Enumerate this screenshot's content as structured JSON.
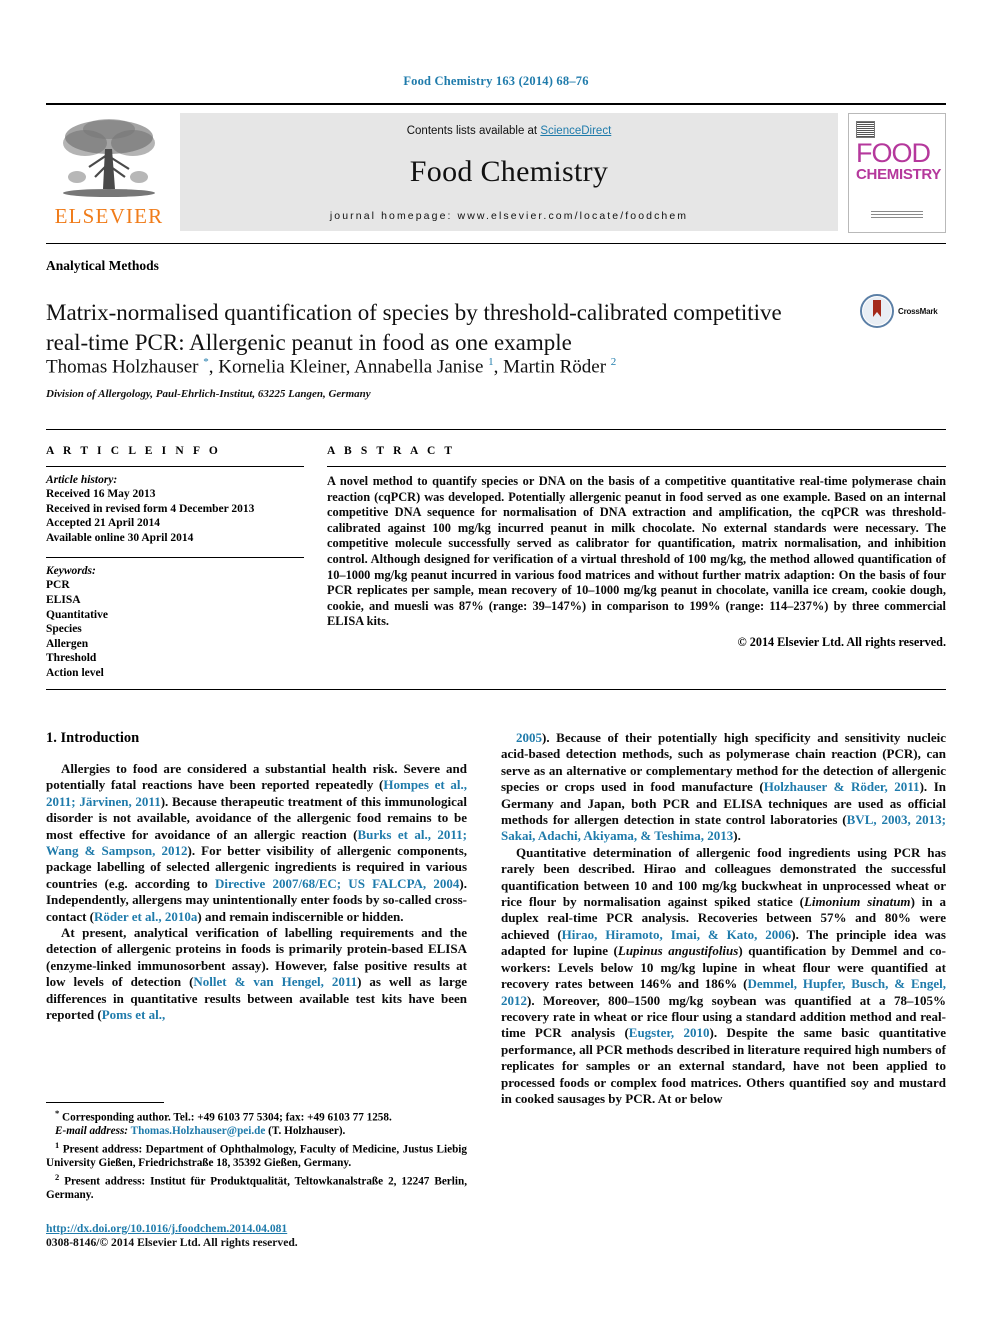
{
  "running_head": "Food Chemistry 163 (2014) 68–76",
  "masthead": {
    "contents_prefix": "Contents lists available at ",
    "contents_link": "ScienceDirect",
    "journal_title": "Food Chemistry",
    "homepage": "journal homepage: www.elsevier.com/locate/foodchem",
    "publisher": "ELSEVIER",
    "cover": {
      "line1": "FOOD",
      "line2": "CHEMISTRY"
    }
  },
  "article": {
    "section_label": "Analytical Methods",
    "title": "Matrix-normalised quantification of species by threshold-calibrated competitive real-time PCR: Allergenic peanut in food as one example",
    "crossmark_label": "CrossMark",
    "authors_html": "Thomas Holzhauser <sup>*</sup>, Kornelia Kleiner, Annabella Janise <sup>1</sup>, Martin Röder <sup>2</sup>",
    "affiliation": "Division of Allergology, Paul-Ehrlich-Institut, 63225 Langen, Germany"
  },
  "info": {
    "heading": "A R T I C L E   I N F O",
    "history_label": "Article history:",
    "history": [
      "Received 16 May 2013",
      "Received in revised form 4 December 2013",
      "Accepted 21 April 2014",
      "Available online 30 April 2014"
    ],
    "keywords_label": "Keywords:",
    "keywords": [
      "PCR",
      "ELISA",
      "Quantitative",
      "Species",
      "Allergen",
      "Threshold",
      "Action level"
    ]
  },
  "abstract": {
    "heading": "A B S T R A C T",
    "text": "A novel method to quantify species or DNA on the basis of a competitive quantitative real-time polymerase chain reaction (cqPCR) was developed. Potentially allergenic peanut in food served as one example. Based on an internal competitive DNA sequence for normalisation of DNA extraction and amplification, the cqPCR was threshold-calibrated against 100 mg/kg incurred peanut in milk chocolate. No external standards were necessary. The competitive molecule successfully served as calibrator for quantification, matrix normalisation, and inhibition control. Although designed for verification of a virtual threshold of 100 mg/kg, the method allowed quantification of 10–1000 mg/kg peanut incurred in various food matrices and without further matrix adaption: On the basis of four PCR replicates per sample, mean recovery of 10–1000 mg/kg peanut in chocolate, vanilla ice cream, cookie dough, cookie, and muesli was 87% (range: 39–147%) in comparison to 199% (range: 114–237%) by three commercial ELISA kits.",
    "copyright": "© 2014 Elsevier Ltd. All rights reserved."
  },
  "introduction": {
    "heading": "1. Introduction",
    "left_paragraphs_html": [
      "Allergies to food are considered a substantial health risk. Severe and potentially fatal reactions have been reported repeatedly (<span class=\"ref\">Hompes et al., 2011; Järvinen, 2011</span>). Because therapeutic treatment of this immunological disorder is not available, avoidance of the allergenic food remains to be most effective for avoidance of an allergic reaction (<span class=\"ref\">Burks et al., 2011; Wang &amp; Sampson, 2012</span>). For better visibility of allergenic components, package labelling of selected allergenic ingredients is required in various countries (e.g. according to <span class=\"ref\">Directive 2007/68/EC; US FALCPA, 2004</span>). Independently, allergens may unintentionally enter foods by so-called cross-contact (<span class=\"ref\">Röder et al., 2010a</span>) and remain indiscernible or hidden.",
      "At present, analytical verification of labelling requirements and the detection of allergenic proteins in foods is primarily protein-based ELISA (enzyme-linked immunosorbent assay). However, false positive results at low levels of detection (<span class=\"ref\">Nollet &amp; van Hengel, 2011</span>) as well as large differences in quantitative results between available test kits have been reported (<span class=\"ref\">Poms et al.,</span>"
    ],
    "right_paragraphs_html": [
      "<span class=\"ref\">2005</span>). Because of their potentially high specificity and sensitivity nucleic acid-based detection methods, such as polymerase chain reaction (PCR), can serve as an alternative or complementary method for the detection of allergenic species or crops used in food manufacture (<span class=\"ref\">Holzhauser &amp; Röder, 2011</span>). In Germany and Japan, both PCR and ELISA techniques are used as official methods for allergen detection in state control laboratories (<span class=\"ref\">BVL, 2003, 2013; Sakai, Adachi, Akiyama, &amp; Teshima, 2013</span>).",
      "Quantitative determination of allergenic food ingredients using PCR has rarely been described. Hirao and colleagues demonstrated the successful quantification between 10 and 100 mg/kg buckwheat in unprocessed wheat or rice flour by normalisation against spiked statice (<i>Limonium sinatum</i>) in a duplex real-time PCR analysis. Recoveries between 57% and 80% were achieved (<span class=\"ref\">Hirao, Hiramoto, Imai, &amp; Kato, 2006</span>). The principle idea was adapted for lupine (<i>Lupinus angustifolius</i>) quantification by Demmel and co-workers: Levels below 10 mg/kg lupine in wheat flour were quantified at recovery rates between 146% and 186% (<span class=\"ref\">Demmel, Hupfer, Busch, &amp; Engel, 2012</span>). Moreover, 800–1500 mg/kg soybean was quantified at a 78–105% recovery rate in wheat or rice flour using a standard addition method and real-time PCR analysis (<span class=\"ref\">Eugster, 2010</span>). Despite the same basic quantitative performance, all PCR methods described in literature required high numbers of replicates for samples or an external standard, have not been applied to processed foods or complex food matrices. Others quantified soy and mustard in cooked sausages by PCR. At or below"
    ]
  },
  "footnotes": {
    "corresponding_html": "<sup class=\"marker\">*</sup> Corresponding author. Tel.: +49 6103 77 5304; fax: +49 6103 77 1258.",
    "email_html": "<i>E-mail address:</i> <span class=\"ref\">Thomas.Holzhauser@pei.de</span> (T. Holzhauser).",
    "present_address_1_html": "<sup class=\"marker\">1</sup> Present address: Department of Ophthalmology, Faculty of Medicine, Justus Liebig University Gießen, Friedrichstraße 18, 35392 Gießen, Germany.",
    "present_address_2_html": "<sup class=\"marker\">2</sup> Present address: Institut für Produktqualität, Teltowkanalstraße 2, 12247 Berlin, Germany."
  },
  "publication": {
    "doi": "http://dx.doi.org/10.1016/j.foodchem.2014.04.081",
    "issn_line": "0308-8146/© 2014 Elsevier Ltd. All rights reserved."
  }
}
